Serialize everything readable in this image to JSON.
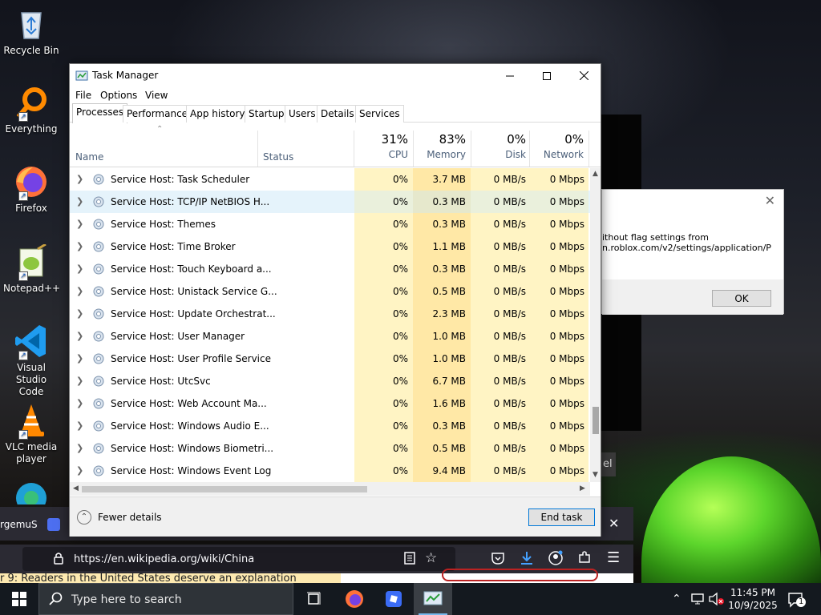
{
  "desktop": {
    "icons": [
      {
        "label": "Recycle Bin"
      },
      {
        "label": "Everything"
      },
      {
        "label": "Firefox"
      },
      {
        "label": "Notepad++"
      },
      {
        "label": "Visual Studio Code"
      },
      {
        "label": "VLC media player"
      }
    ]
  },
  "error_dialog": {
    "line1": "ithout flag settings from",
    "line2": "n.roblox.com/v2/settings/application/P",
    "ok_label": "OK",
    "side_button_fragment": "el"
  },
  "browser": {
    "tab_fragment": "rgemuS",
    "url": "https://en.wikipedia.org/wiki/China",
    "banner_text": "r 9: Readers in the United States deserve an explanation"
  },
  "taskmgr": {
    "title": "Task Manager",
    "menu": [
      "File",
      "Options",
      "View"
    ],
    "tabs": [
      "Processes",
      "Performance",
      "App history",
      "Startup",
      "Users",
      "Details",
      "Services"
    ],
    "active_tab": "Processes",
    "columns": {
      "name": "Name",
      "status": "Status",
      "cpu": {
        "pct": "31%",
        "label": "CPU"
      },
      "memory": {
        "pct": "83%",
        "label": "Memory"
      },
      "disk": {
        "pct": "0%",
        "label": "Disk"
      },
      "network": {
        "pct": "0%",
        "label": "Network"
      }
    },
    "processes": [
      {
        "name": "Service Host: Task Scheduler",
        "cpu": "0%",
        "memory": "3.7 MB",
        "disk": "0 MB/s",
        "network": "0 Mbps"
      },
      {
        "name": "Service Host: TCP/IP NetBIOS H...",
        "cpu": "0%",
        "memory": "0.3 MB",
        "disk": "0 MB/s",
        "network": "0 Mbps",
        "selected": true
      },
      {
        "name": "Service Host: Themes",
        "cpu": "0%",
        "memory": "0.3 MB",
        "disk": "0 MB/s",
        "network": "0 Mbps"
      },
      {
        "name": "Service Host: Time Broker",
        "cpu": "0%",
        "memory": "1.1 MB",
        "disk": "0 MB/s",
        "network": "0 Mbps"
      },
      {
        "name": "Service Host: Touch Keyboard a...",
        "cpu": "0%",
        "memory": "0.3 MB",
        "disk": "0 MB/s",
        "network": "0 Mbps"
      },
      {
        "name": "Service Host: Unistack Service G...",
        "cpu": "0%",
        "memory": "0.5 MB",
        "disk": "0 MB/s",
        "network": "0 Mbps"
      },
      {
        "name": "Service Host: Update Orchestrat...",
        "cpu": "0%",
        "memory": "2.3 MB",
        "disk": "0 MB/s",
        "network": "0 Mbps"
      },
      {
        "name": "Service Host: User Manager",
        "cpu": "0%",
        "memory": "1.0 MB",
        "disk": "0 MB/s",
        "network": "0 Mbps"
      },
      {
        "name": "Service Host: User Profile Service",
        "cpu": "0%",
        "memory": "1.0 MB",
        "disk": "0 MB/s",
        "network": "0 Mbps"
      },
      {
        "name": "Service Host: UtcSvc",
        "cpu": "0%",
        "memory": "6.7 MB",
        "disk": "0 MB/s",
        "network": "0 Mbps"
      },
      {
        "name": "Service Host: Web Account Ma...",
        "cpu": "0%",
        "memory": "1.6 MB",
        "disk": "0 MB/s",
        "network": "0 Mbps"
      },
      {
        "name": "Service Host: Windows Audio E...",
        "cpu": "0%",
        "memory": "0.3 MB",
        "disk": "0 MB/s",
        "network": "0 Mbps"
      },
      {
        "name": "Service Host: Windows Biometri...",
        "cpu": "0%",
        "memory": "0.5 MB",
        "disk": "0 MB/s",
        "network": "0 Mbps"
      },
      {
        "name": "Service Host: Windows Event Log",
        "cpu": "0%",
        "memory": "9.4 MB",
        "disk": "0 MB/s",
        "network": "0 Mbps"
      }
    ],
    "fewer_details_label": "Fewer details",
    "end_task_label": "End task"
  },
  "taskbar": {
    "search_placeholder": "Type here to search",
    "time": "11:45 PM",
    "date": "10/9/2025",
    "notification_count": "1"
  },
  "colors": {
    "cpu_col": "#fff4c4",
    "memory_col": "#ffe8a6",
    "selection": "#e5f3fb",
    "accent": "#0078d7"
  }
}
